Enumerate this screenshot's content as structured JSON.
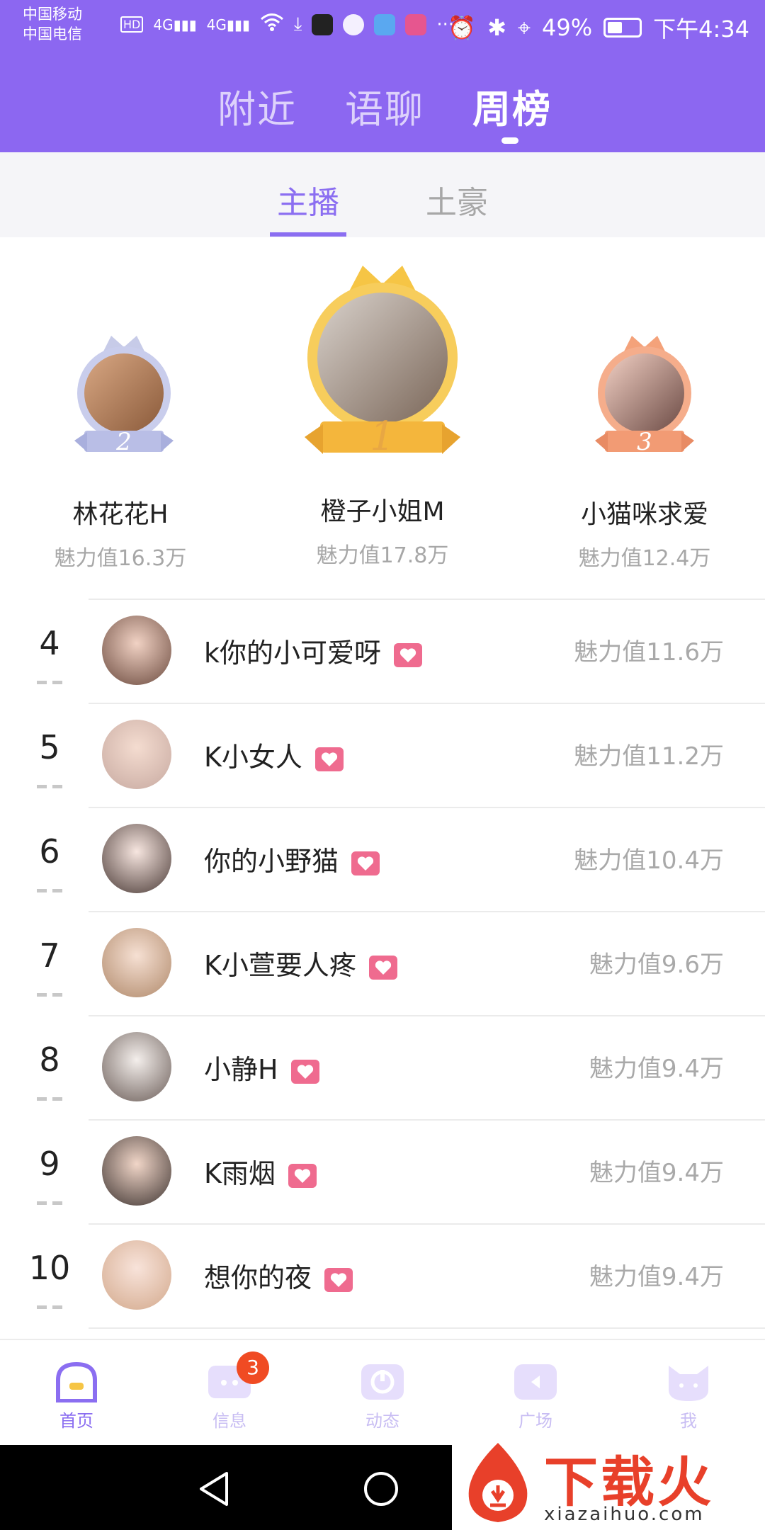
{
  "status_bar": {
    "carrier1": "中国移动",
    "carrier2": "中国电信",
    "network_tag": "HD",
    "signal1": "4G",
    "signal2": "4G",
    "battery": "49%",
    "time": "下午4:34"
  },
  "main_tabs": [
    "附近",
    "语聊",
    "周榜"
  ],
  "sub_tabs": [
    "主播",
    "土豪"
  ],
  "podium": [
    {
      "rank": "2",
      "name": "林花花H",
      "score": "魅力值16.3万"
    },
    {
      "rank": "1",
      "name": "橙子小姐M",
      "score": "魅力值17.8万"
    },
    {
      "rank": "3",
      "name": "小猫咪求爱",
      "score": "魅力值12.4万"
    }
  ],
  "list": [
    {
      "rank": "4",
      "name": "k你的小可爱呀",
      "score": "魅力值11.6万"
    },
    {
      "rank": "5",
      "name": "K小女人",
      "score": "魅力值11.2万"
    },
    {
      "rank": "6",
      "name": "你的小野猫",
      "score": "魅力值10.4万"
    },
    {
      "rank": "7",
      "name": "K小萱要人疼",
      "score": "魅力值9.6万"
    },
    {
      "rank": "8",
      "name": "小静H",
      "score": "魅力值9.4万"
    },
    {
      "rank": "9",
      "name": "K雨烟",
      "score": "魅力值9.4万"
    },
    {
      "rank": "10",
      "name": "想你的夜",
      "score": "魅力值9.4万"
    }
  ],
  "bottom_nav": [
    {
      "label": "首页",
      "icon": "home-icon"
    },
    {
      "label": "信息",
      "icon": "message-icon",
      "badge": "3"
    },
    {
      "label": "动态",
      "icon": "moments-icon"
    },
    {
      "label": "广场",
      "icon": "square-icon"
    },
    {
      "label": "我",
      "icon": "profile-icon"
    }
  ],
  "watermark": {
    "brand": "下载火",
    "url": "xiazaihuo.com"
  },
  "colors": {
    "primary": "#8c67f1",
    "heart": "#ef6b8f",
    "badge": "#f04b23"
  }
}
